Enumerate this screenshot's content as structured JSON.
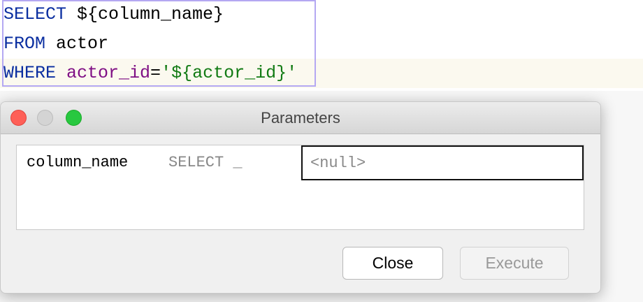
{
  "editor": {
    "lines": [
      {
        "keyword": "SELECT",
        "rest": " ${column_name}"
      },
      {
        "keyword": "FROM",
        "rest": " actor"
      },
      {
        "keyword": "WHERE",
        "ident": " actor_id",
        "op": "=",
        "string": "'${actor_id}'"
      }
    ]
  },
  "dialog": {
    "title": "Parameters",
    "params": [
      {
        "name": "column_name",
        "context": "SELECT _",
        "value_placeholder": "<null>"
      }
    ],
    "close_label": "Close",
    "execute_label": "Execute"
  }
}
